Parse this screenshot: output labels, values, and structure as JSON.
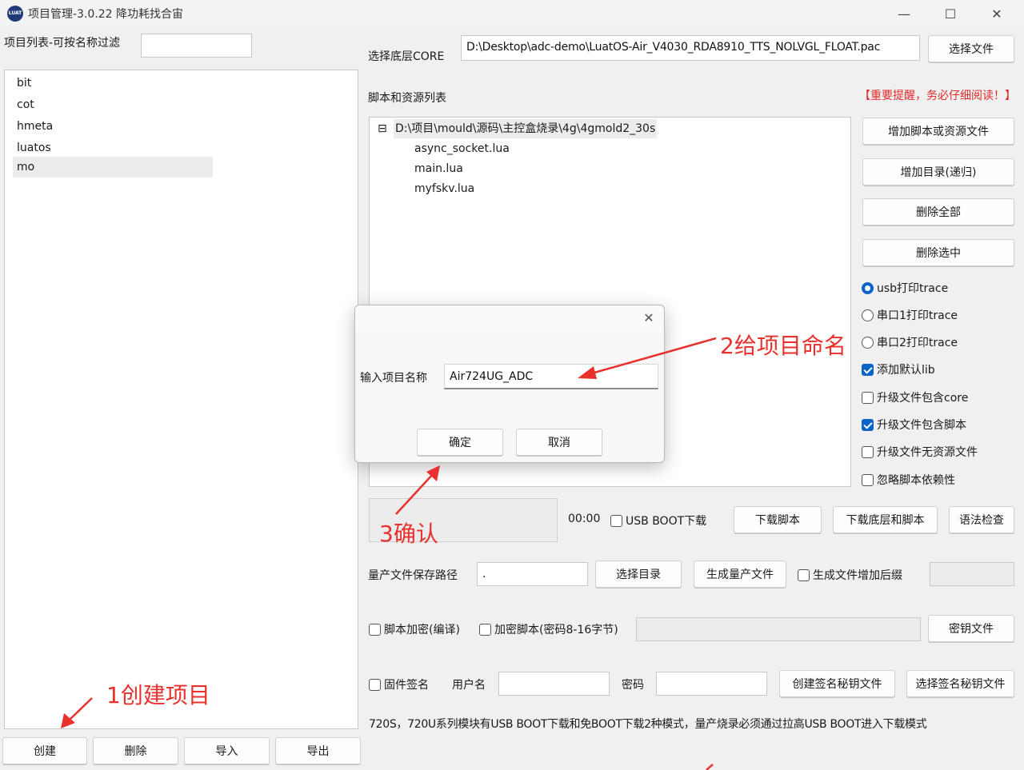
{
  "window": {
    "title": "项目管理-3.0.22 降功耗找合宙",
    "icon_text": "LUAT",
    "minimize": "—",
    "maximize": "☐",
    "close": "✕"
  },
  "left": {
    "filter_label": "项目列表-可按名称过滤",
    "filter_value": "",
    "projects": [
      "bit",
      "cot",
      "hmeta",
      "luatos",
      "mo"
    ],
    "buttons": {
      "create": "创建",
      "delete": "删除",
      "import": "导入",
      "export": "导出"
    }
  },
  "core": {
    "label": "选择底层CORE",
    "path": "D:\\Desktop\\adc-demo\\LuatOS-Air_V4030_RDA8910_TTS_NOLVGL_FLOAT.pac",
    "select_button": "选择文件"
  },
  "scripts": {
    "label": "脚本和资源列表",
    "warning": "【重要提醒，务必仔细阅读！】",
    "tree_collapse": "⊟",
    "tree_root": "D:\\项目\\mould\\源码\\主控盒烧录\\4g\\4gmold2_30s",
    "files": [
      "async_socket.lua",
      "main.lua",
      "myfskv.lua"
    ]
  },
  "side_buttons": {
    "add_script": "增加脚本或资源文件",
    "add_dir": "增加目录(递归)",
    "delete_all": "删除全部",
    "delete_selected": "删除选中"
  },
  "options": {
    "radios": [
      {
        "label": "usb打印trace",
        "checked": true
      },
      {
        "label": "串口1打印trace",
        "checked": false
      },
      {
        "label": "串口2打印trace",
        "checked": false
      }
    ],
    "checks": [
      {
        "label": "添加默认lib",
        "checked": true
      },
      {
        "label": "升级文件包含core",
        "checked": false
      },
      {
        "label": "升级文件包含脚本",
        "checked": true
      },
      {
        "label": "升级文件无资源文件",
        "checked": false
      },
      {
        "label": "忽略脚本依赖性",
        "checked": false
      }
    ]
  },
  "download": {
    "time": "00:00",
    "usb_boot_label": "USB BOOT下载",
    "download_script": "下载脚本",
    "download_core_script": "下载底层和脚本",
    "syntax_check": "语法检查"
  },
  "production": {
    "label": "量产文件保存路径",
    "path_value": ".",
    "select_dir": "选择目录",
    "generate": "生成量产文件",
    "add_suffix_label": "生成文件增加后缀",
    "suffix_value": ""
  },
  "encrypt": {
    "script_encrypt_label": "脚本加密(编译)",
    "encrypt_script_label": "加密脚本(密码8-16字节)",
    "key_value": "",
    "key_file_button": "密钥文件"
  },
  "signing": {
    "fw_sign_label": "固件签名",
    "username_label": "用户名",
    "username_value": "",
    "password_label": "密码",
    "password_value": "",
    "create_key_button": "创建签名秘钥文件",
    "select_key_button": "选择签名秘钥文件"
  },
  "footer_note": "720S，720U系列模块有USB BOOT下载和免BOOT下载2种模式，量产烧录必须通过拉高USB BOOT进入下载模式",
  "dialog": {
    "close": "✕",
    "name_label": "输入项目名称",
    "name_value": "Air724UG_ADC",
    "ok": "确定",
    "cancel": "取消"
  },
  "annotations": {
    "step1": "1创建项目",
    "step2": "2给项目命名",
    "step3": "3确认",
    "color": "#e8312d"
  }
}
